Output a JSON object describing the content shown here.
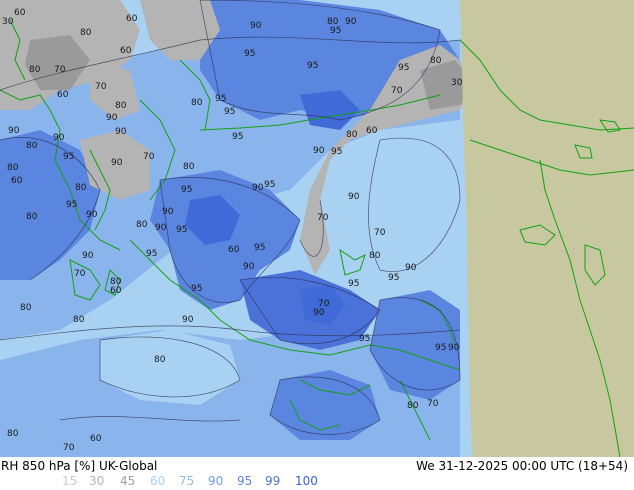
{
  "map": {
    "colors": {
      "ocean_light": "#a9d2f2",
      "ocean_mid": "#8ab5ec",
      "ocean_dark": "#5b86e0",
      "ocean_deep": "#3f6ad8",
      "grey_land": "#b4b4b4",
      "grey_dark": "#9a9a9a",
      "outside_domain": "#c8c8a0",
      "coastline": "#14a014"
    },
    "contour_labels": [
      {
        "id": "l1",
        "text": "30"
      },
      {
        "id": "l2",
        "text": "60"
      },
      {
        "id": "l3",
        "text": "60"
      },
      {
        "id": "l4",
        "text": "80"
      },
      {
        "id": "l5",
        "text": "90"
      },
      {
        "id": "l6",
        "text": "80"
      },
      {
        "id": "l7",
        "text": "90"
      },
      {
        "id": "l8",
        "text": "95"
      },
      {
        "id": "l9",
        "text": "60"
      },
      {
        "id": "l10",
        "text": "95"
      },
      {
        "id": "l11",
        "text": "95"
      },
      {
        "id": "l12",
        "text": "80"
      },
      {
        "id": "l13",
        "text": "80"
      },
      {
        "id": "l14",
        "text": "70"
      },
      {
        "id": "l15",
        "text": "70"
      },
      {
        "id": "l16",
        "text": "30"
      },
      {
        "id": "l17",
        "text": "60"
      },
      {
        "id": "l18",
        "text": "80"
      },
      {
        "id": "l19",
        "text": "80"
      },
      {
        "id": "l20",
        "text": "95"
      },
      {
        "id": "l21",
        "text": "95"
      },
      {
        "id": "l22",
        "text": "90"
      },
      {
        "id": "l23",
        "text": "90"
      },
      {
        "id": "l24",
        "text": "95"
      },
      {
        "id": "l25",
        "text": "80"
      },
      {
        "id": "l26",
        "text": "60"
      },
      {
        "id": "l27",
        "text": "95"
      },
      {
        "id": "l28",
        "text": "90"
      },
      {
        "id": "l29",
        "text": "90"
      },
      {
        "id": "l30",
        "text": "70"
      },
      {
        "id": "l31",
        "text": "80"
      },
      {
        "id": "l32",
        "text": "80"
      },
      {
        "id": "l33",
        "text": "95"
      },
      {
        "id": "l34",
        "text": "90"
      },
      {
        "id": "l35",
        "text": "95"
      },
      {
        "id": "l36",
        "text": "90"
      },
      {
        "id": "l37",
        "text": "90"
      },
      {
        "id": "l38",
        "text": "80"
      },
      {
        "id": "l39",
        "text": "90"
      },
      {
        "id": "l40",
        "text": "60"
      },
      {
        "id": "l41",
        "text": "95"
      },
      {
        "id": "l42",
        "text": "70"
      },
      {
        "id": "l43",
        "text": "95"
      },
      {
        "id": "l44",
        "text": "80"
      },
      {
        "id": "l45",
        "text": "95"
      },
      {
        "id": "l46",
        "text": "90"
      },
      {
        "id": "l47",
        "text": "90"
      },
      {
        "id": "l48",
        "text": "70"
      },
      {
        "id": "l49",
        "text": "90"
      },
      {
        "id": "l50",
        "text": "80"
      },
      {
        "id": "l51",
        "text": "95"
      },
      {
        "id": "l52",
        "text": "70"
      },
      {
        "id": "l53",
        "text": "80"
      },
      {
        "id": "l54",
        "text": "60"
      },
      {
        "id": "l55",
        "text": "95"
      },
      {
        "id": "l56",
        "text": "95"
      },
      {
        "id": "l57",
        "text": "90"
      },
      {
        "id": "l58",
        "text": "80"
      },
      {
        "id": "l59",
        "text": "70"
      },
      {
        "id": "l60",
        "text": "90"
      },
      {
        "id": "l61",
        "text": "80"
      },
      {
        "id": "l62",
        "text": "90"
      },
      {
        "id": "l63",
        "text": "95"
      },
      {
        "id": "l64",
        "text": "80"
      },
      {
        "id": "l65",
        "text": "90"
      },
      {
        "id": "l66",
        "text": "95"
      },
      {
        "id": "l67",
        "text": "95"
      },
      {
        "id": "l68",
        "text": "90"
      },
      {
        "id": "l69",
        "text": "60"
      },
      {
        "id": "l70",
        "text": "70"
      },
      {
        "id": "l71",
        "text": "90"
      },
      {
        "id": "l72",
        "text": "80"
      },
      {
        "id": "l73",
        "text": "95"
      },
      {
        "id": "l74",
        "text": "80"
      },
      {
        "id": "l75",
        "text": "95"
      },
      {
        "id": "l76",
        "text": "80"
      },
      {
        "id": "l77",
        "text": "60"
      },
      {
        "id": "l78",
        "text": "70"
      },
      {
        "id": "l79",
        "text": "80"
      },
      {
        "id": "l80",
        "text": "70"
      }
    ]
  },
  "footer": {
    "title": "RH 850 hPa [%] UK-Global",
    "datetime": "We 31-12-2025 00:00 UTC (18+54)",
    "scale": [
      {
        "label": "15",
        "color": "#c8c8c8"
      },
      {
        "label": "30",
        "color": "#b4b4b4"
      },
      {
        "label": "45",
        "color": "#a0a0a0"
      },
      {
        "label": "60",
        "color": "#a9d2f2"
      },
      {
        "label": "75",
        "color": "#8cbef0"
      },
      {
        "label": "90",
        "color": "#6e9ee8"
      },
      {
        "label": "95",
        "color": "#5b86e0"
      },
      {
        "label": "99",
        "color": "#4a72d8"
      },
      {
        "label": "100",
        "color": "#3a5ed0"
      }
    ]
  }
}
